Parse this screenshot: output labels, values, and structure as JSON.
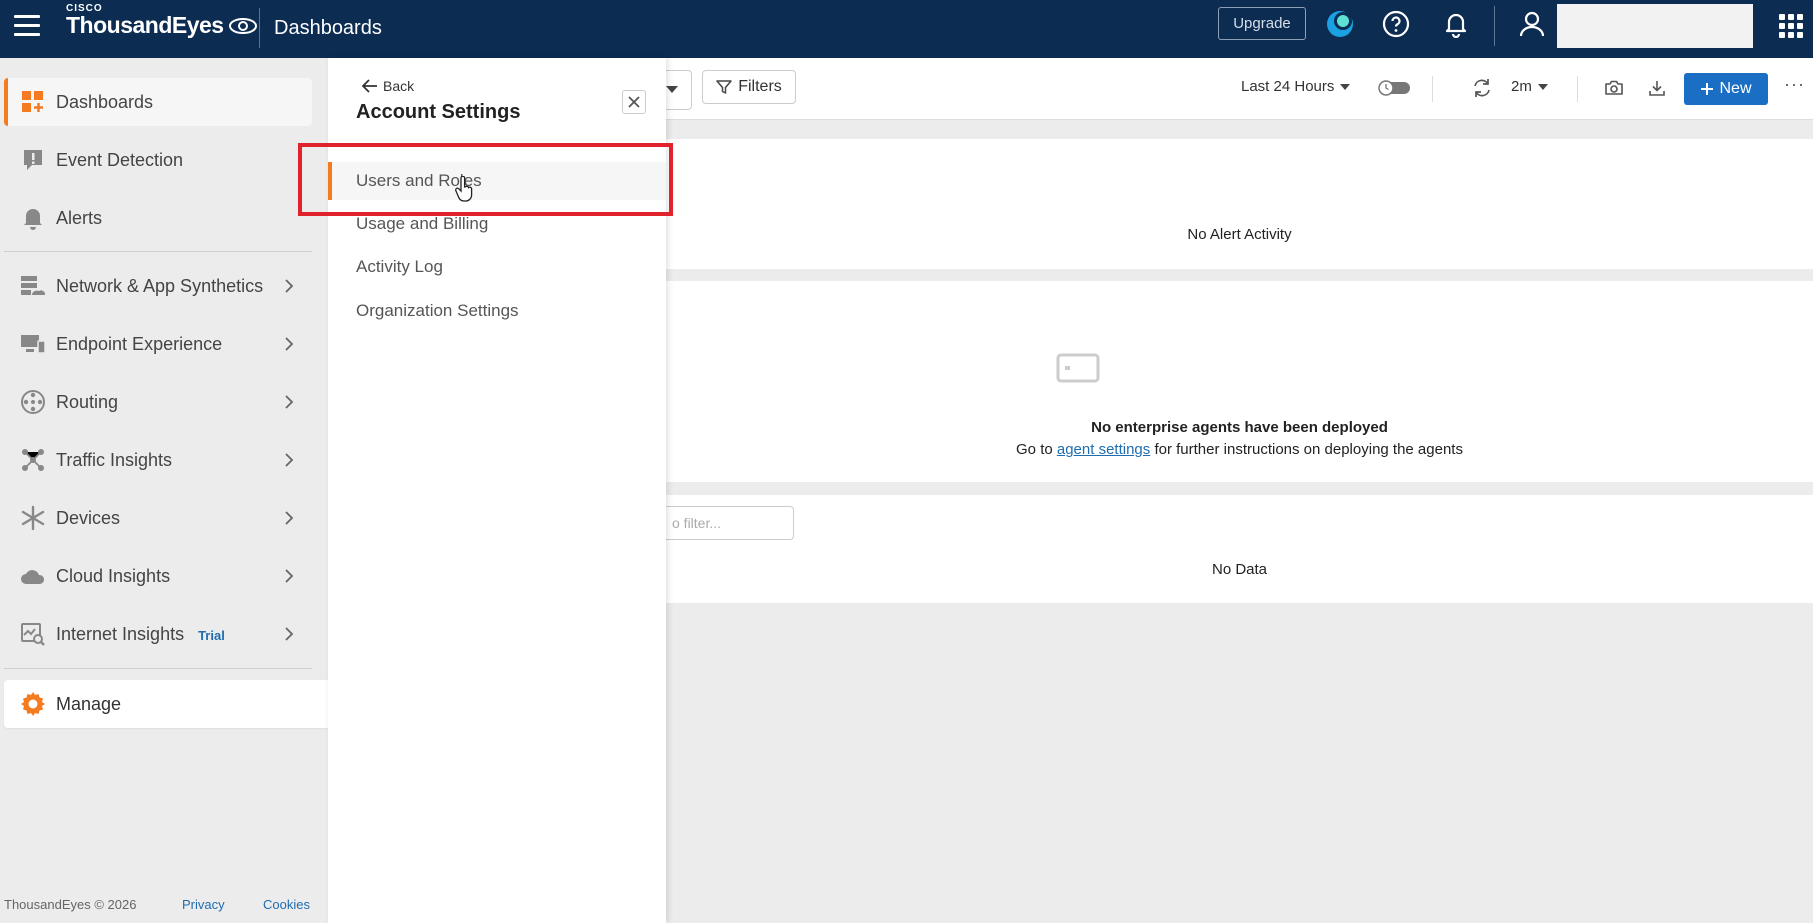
{
  "topbar": {
    "brand_small": "CISCO",
    "brand_name": "ThousandEyes",
    "app_title": "Dashboards",
    "upgrade_label": "Upgrade"
  },
  "sidebar": {
    "items": [
      {
        "label": "Dashboards"
      },
      {
        "label": "Event Detection"
      },
      {
        "label": "Alerts"
      },
      {
        "label": "Network & App Synthetics"
      },
      {
        "label": "Endpoint Experience"
      },
      {
        "label": "Routing"
      },
      {
        "label": "Traffic Insights"
      },
      {
        "label": "Devices"
      },
      {
        "label": "Cloud Insights"
      },
      {
        "label": "Internet Insights",
        "badge": "Trial"
      },
      {
        "label": "Manage"
      }
    ],
    "footer": {
      "copyright": "ThousandEyes © 2026",
      "privacy": "Privacy",
      "cookies": "Cookies"
    }
  },
  "panel": {
    "back_label": "Back",
    "title": "Account Settings",
    "menu": [
      {
        "label": "Users and Roles"
      },
      {
        "label": "Usage and Billing"
      },
      {
        "label": "Activity Log"
      },
      {
        "label": "Organization Settings"
      }
    ]
  },
  "toolbar": {
    "filters_label": "Filters",
    "time_range": "Last 24 Hours",
    "refresh_interval": "2m",
    "new_label": "New"
  },
  "widgets": {
    "alerts_empty": "No Alert Activity",
    "agents_title": "No enterprise agents have been deployed",
    "agents_prefix": "Go to",
    "agents_link": "agent settings",
    "agents_suffix": "for further instructions on deploying the agents",
    "filter_placeholder": "o filter...",
    "no_data": "No Data"
  },
  "colors": {
    "topbar": "#0c2c52",
    "accent": "#f47b20",
    "primary_button": "#1a6fc4",
    "highlight": "#e0232b"
  }
}
